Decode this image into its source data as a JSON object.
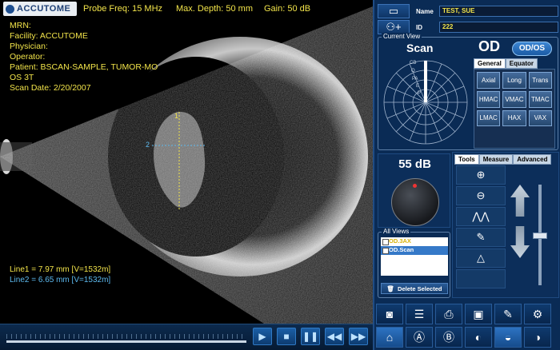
{
  "header": {
    "logo_text": "ACCUTOME",
    "probe_freq": "Probe Freq: 15 MHz",
    "max_depth": "Max. Depth: 50 mm",
    "gain": "Gain: 50 dB"
  },
  "patient_info": [
    "MRN:",
    "Facility: ACCUTOME",
    "Physician:",
    "Operator:",
    "Patient: BSCAN-SAMPLE, TUMOR-MO",
    "OS 3T",
    "Scan Date: 2/20/2007"
  ],
  "measurements": {
    "line1": "Line1 = 7.97 mm    [V=1532m]",
    "line2": "Line2 = 6.65 mm    [V=1532m]",
    "marker1": "1",
    "marker2": "2"
  },
  "patient_panel": {
    "name_label": "Name",
    "name_value": "TEST, SUE",
    "id_label": "ID",
    "id_value": "222"
  },
  "current_view": {
    "group_title": "Current View",
    "scan_label": "Scan",
    "eye": "OD",
    "odos_button": "OD/OS",
    "polar_labels": [
      "CB",
      "O",
      "PA",
      "E",
      "P"
    ],
    "tabs": [
      "General",
      "Equator"
    ],
    "view_buttons": [
      "Axial",
      "Long",
      "Trans",
      "HMAC",
      "VMAC",
      "TMAC",
      "LMAC",
      "HAX",
      "VAX"
    ]
  },
  "gain_control": {
    "value": "55 dB"
  },
  "tools": {
    "tabs": [
      "Tools",
      "Measure",
      "Advanced"
    ]
  },
  "all_views": {
    "title": "All Views",
    "items": [
      "OD.3AX",
      "OD.Scan"
    ],
    "delete_label": "Delete Selected"
  },
  "colors": {
    "overlay_text": "#f2e44a",
    "line2": "#5db9ee",
    "panel_bg": "#0a2b55"
  }
}
